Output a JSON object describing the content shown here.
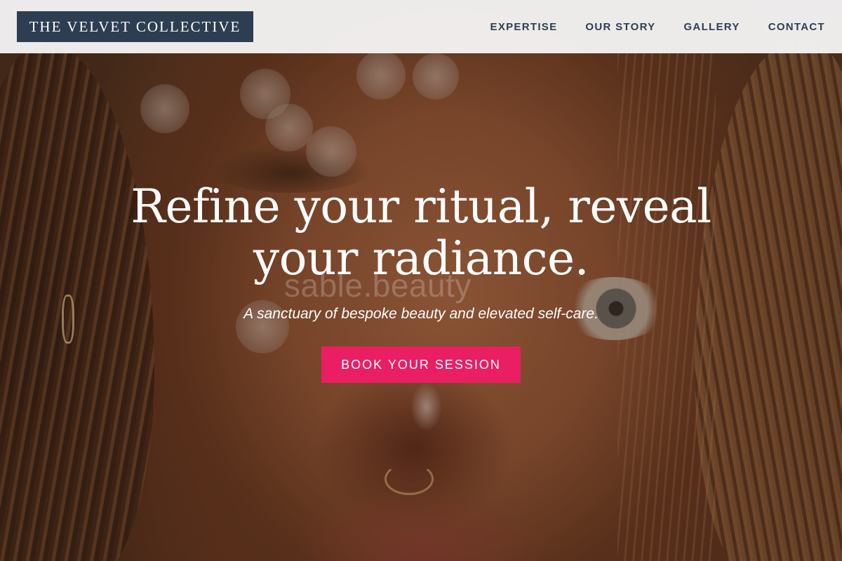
{
  "brand": {
    "name": "THE VELVET COLLECTIVE",
    "color": "#2d3e52"
  },
  "nav": {
    "items": [
      {
        "label": "EXPERTISE"
      },
      {
        "label": "OUR STORY"
      },
      {
        "label": "GALLERY"
      },
      {
        "label": "CONTACT"
      }
    ]
  },
  "hero": {
    "headline": "Refine your ritual, reveal your radiance.",
    "watermark": "sable.beauty",
    "subtitle": "A sanctuary of bespoke beauty and elevated self-care.",
    "cta_label": "BOOK YOUR SESSION",
    "cta_color": "#e91e63",
    "background_image": "close-up portrait photo"
  }
}
